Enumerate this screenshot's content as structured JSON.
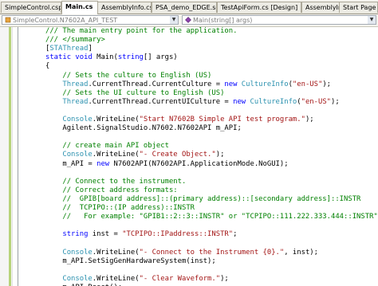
{
  "tabs": [
    {
      "label": "SimpleControl.csproj",
      "active": false
    },
    {
      "label": "Main.cs",
      "active": true
    },
    {
      "label": "AssemblyInfo.cs",
      "active": false
    },
    {
      "label": "PSA_demo_EDGE.scp",
      "active": false
    },
    {
      "label": "TestApiForm.cs [Design]",
      "active": false
    },
    {
      "label": "AssemblyInfo.cs",
      "active": false
    },
    {
      "label": "Start Page",
      "active": false
    }
  ],
  "nav": {
    "class_combo": "SimpleControl.N7602A_API_TEST",
    "member_combo": "Main(string[] args)"
  },
  "code_lines": [
    [
      {
        "t": "/// The main entry point for the application.",
        "c": "cmt"
      }
    ],
    [
      {
        "t": "/// </summary>",
        "c": "cmt"
      }
    ],
    [
      {
        "t": "[",
        "c": ""
      },
      {
        "t": "STAThread",
        "c": "typ"
      },
      {
        "t": "]",
        "c": ""
      }
    ],
    [
      {
        "t": "static void ",
        "c": "kw"
      },
      {
        "t": "Main(",
        "c": ""
      },
      {
        "t": "string",
        "c": "kw"
      },
      {
        "t": "[] args)",
        "c": ""
      }
    ],
    [
      {
        "t": "{",
        "c": ""
      }
    ],
    [
      {
        "t": "    // Sets the culture to English (US)",
        "c": "cmt"
      }
    ],
    [
      {
        "t": "    ",
        "c": ""
      },
      {
        "t": "Thread",
        "c": "typ"
      },
      {
        "t": ".CurrentThread.CurrentCulture = ",
        "c": ""
      },
      {
        "t": "new ",
        "c": "kw"
      },
      {
        "t": "CultureInfo",
        "c": "typ"
      },
      {
        "t": "(",
        "c": ""
      },
      {
        "t": "\"en-US\"",
        "c": "str"
      },
      {
        "t": ");",
        "c": ""
      }
    ],
    [
      {
        "t": "    // Sets the UI culture to English (US)",
        "c": "cmt"
      }
    ],
    [
      {
        "t": "    ",
        "c": ""
      },
      {
        "t": "Thread",
        "c": "typ"
      },
      {
        "t": ".CurrentThread.CurrentUICulture = ",
        "c": ""
      },
      {
        "t": "new ",
        "c": "kw"
      },
      {
        "t": "CultureInfo",
        "c": "typ"
      },
      {
        "t": "(",
        "c": ""
      },
      {
        "t": "\"en-US\"",
        "c": "str"
      },
      {
        "t": ");",
        "c": ""
      }
    ],
    [],
    [
      {
        "t": "    ",
        "c": ""
      },
      {
        "t": "Console",
        "c": "typ"
      },
      {
        "t": ".WriteLine(",
        "c": ""
      },
      {
        "t": "\"Start N7602B Simple API test program.\"",
        "c": "str"
      },
      {
        "t": ");",
        "c": ""
      }
    ],
    [
      {
        "t": "    Agilent.SignalStudio.N7602.N7602API m_API;",
        "c": ""
      }
    ],
    [],
    [
      {
        "t": "    // create main API object",
        "c": "cmt"
      }
    ],
    [
      {
        "t": "    ",
        "c": ""
      },
      {
        "t": "Console",
        "c": "typ"
      },
      {
        "t": ".WriteLine(",
        "c": ""
      },
      {
        "t": "\"- Create Object.\"",
        "c": "str"
      },
      {
        "t": ");",
        "c": ""
      }
    ],
    [
      {
        "t": "    m_API = ",
        "c": ""
      },
      {
        "t": "new ",
        "c": "kw"
      },
      {
        "t": "N7602API(N7602API.ApplicationMode.NoGUI);",
        "c": ""
      }
    ],
    [],
    [
      {
        "t": "    // Connect to the instrument.",
        "c": "cmt"
      }
    ],
    [
      {
        "t": "    // Correct address formats:",
        "c": "cmt"
      }
    ],
    [
      {
        "t": "    //  GPIB[board address]::(primary address)::[secondary address]::INSTR",
        "c": "cmt"
      }
    ],
    [
      {
        "t": "    //  TCPIPO::(IP address)::INSTR",
        "c": "cmt"
      }
    ],
    [
      {
        "t": "    //   For example: \"GPIB1::2::3::INSTR\" or \"TCPIPO::111.222.333.444::INSTR\"",
        "c": "cmt"
      }
    ],
    [],
    [
      {
        "t": "    ",
        "c": ""
      },
      {
        "t": "string ",
        "c": "kw"
      },
      {
        "t": "inst = ",
        "c": ""
      },
      {
        "t": "\"TCPIPO::IPaddress::INSTR\"",
        "c": "str"
      },
      {
        "t": ";",
        "c": ""
      }
    ],
    [],
    [
      {
        "t": "    ",
        "c": ""
      },
      {
        "t": "Console",
        "c": "typ"
      },
      {
        "t": ".WriteLine(",
        "c": ""
      },
      {
        "t": "\"- Connect to the Instrument {0}.\"",
        "c": "str"
      },
      {
        "t": ", inst);",
        "c": ""
      }
    ],
    [
      {
        "t": "    m_API.SetSigGenHardwareSystem(inst);",
        "c": ""
      }
    ],
    [],
    [
      {
        "t": "    ",
        "c": ""
      },
      {
        "t": "Console",
        "c": "typ"
      },
      {
        "t": ".WriteLine(",
        "c": ""
      },
      {
        "t": "\"- Clear Waveform.\"",
        "c": "str"
      },
      {
        "t": ");",
        "c": ""
      }
    ],
    [
      {
        "t": "    m_API.Reset();",
        "c": ""
      }
    ]
  ]
}
